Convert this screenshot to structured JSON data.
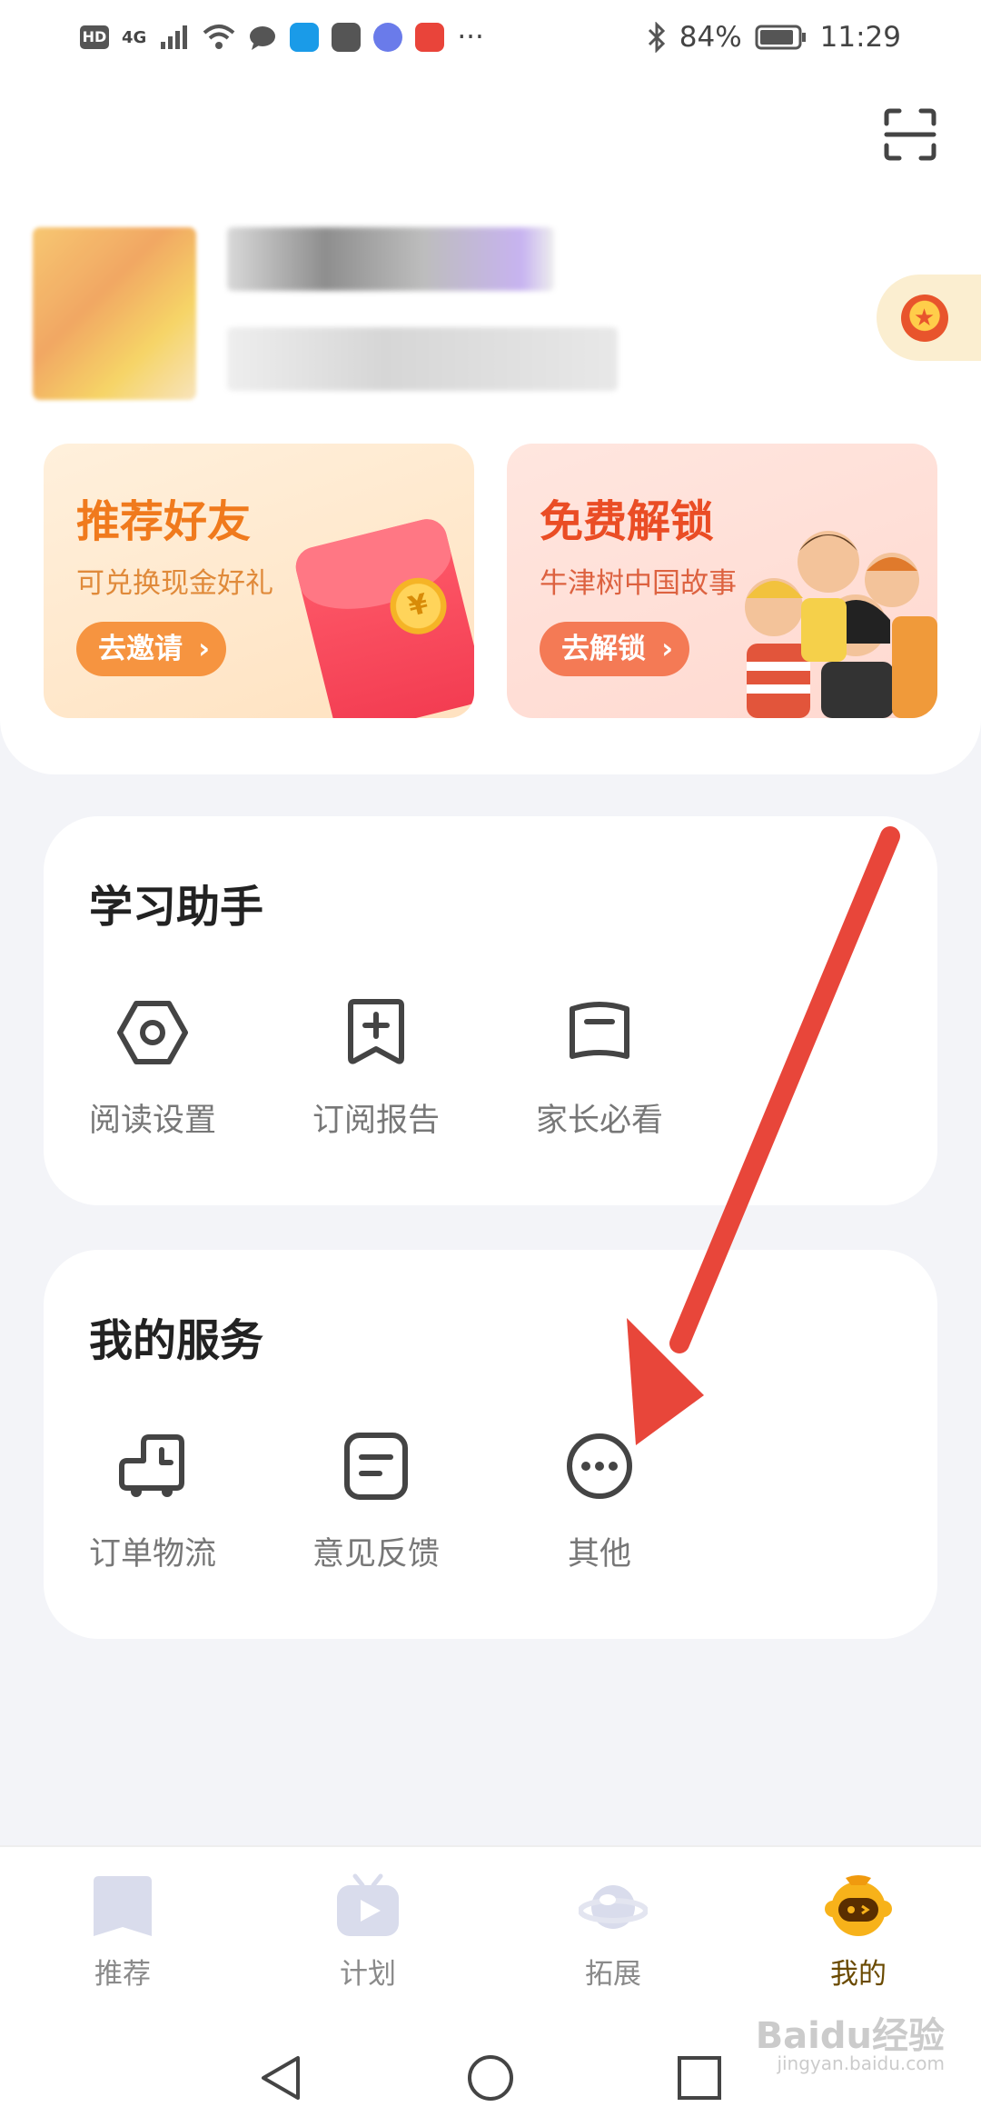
{
  "status_bar": {
    "left_badge": "HD",
    "network": "4G",
    "battery": "84%",
    "time": "11:29"
  },
  "profile": {
    "medal_icon": "medal-icon"
  },
  "promos": [
    {
      "title": "推荐好友",
      "subtitle": "可兑换现金好礼",
      "button": "去邀请"
    },
    {
      "title": "免费解锁",
      "subtitle": "牛津树中国故事",
      "button": "去解锁"
    }
  ],
  "learning": {
    "title": "学习助手",
    "items": [
      {
        "label": "阅读设置",
        "icon": "hexagon-settings-icon"
      },
      {
        "label": "订阅报告",
        "icon": "bookmark-plus-icon"
      },
      {
        "label": "家长必看",
        "icon": "book-icon"
      }
    ]
  },
  "services": {
    "title": "我的服务",
    "items": [
      {
        "label": "订单物流",
        "icon": "delivery-truck-icon"
      },
      {
        "label": "意见反馈",
        "icon": "feedback-note-icon"
      },
      {
        "label": "其他",
        "icon": "more-dots-icon"
      }
    ]
  },
  "bottom_nav": [
    {
      "label": "推荐",
      "icon": "recommend-icon",
      "active": false
    },
    {
      "label": "计划",
      "icon": "plan-tv-icon",
      "active": false
    },
    {
      "label": "拓展",
      "icon": "planet-icon",
      "active": false
    },
    {
      "label": "我的",
      "icon": "mascot-icon",
      "active": true
    }
  ],
  "watermark": {
    "text": "Baidu经验",
    "sub": "jingyan.baidu.com"
  },
  "colors": {
    "accent_orange": "#f07a1d",
    "accent_red": "#ea4d25",
    "arrow": "#e8463a",
    "active_tab": "#6a4a00"
  }
}
